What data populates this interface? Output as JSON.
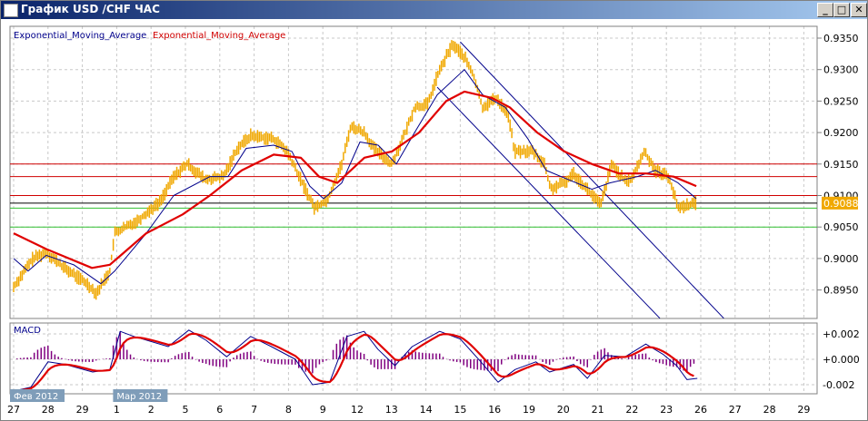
{
  "window": {
    "title": "График USD /CHF  ЧАС",
    "minimize": "_",
    "maximize": "□",
    "close": "✕"
  },
  "legend": {
    "ema_fast": "Exponential_Moving_Average",
    "ema_slow": "Exponential_Moving_Average"
  },
  "colors": {
    "price": "#f0a800",
    "ema_fast": "#00008b",
    "ema_slow": "#e00000",
    "macd_hist": "#800080",
    "grid": "#c8c8c8"
  },
  "chart_data": [
    {
      "type": "line",
      "title": "USD/CHF H1",
      "x_ticks": [
        "27",
        "28",
        "29",
        "1",
        "2",
        "5",
        "6",
        "7",
        "8",
        "9",
        "12",
        "13",
        "14",
        "15",
        "16",
        "19",
        "20",
        "21",
        "22",
        "23",
        "26",
        "27",
        "28",
        "29"
      ],
      "month_labels": [
        {
          "idx": 0,
          "text": "Фев 2012"
        },
        {
          "idx": 3,
          "text": "Мар 2012"
        }
      ],
      "y_ticks": [
        "0.9350",
        "0.9300",
        "0.9250",
        "0.9200",
        "0.9150",
        "0.9100",
        "0.9050",
        "0.9000",
        "0.8950"
      ],
      "ylim": [
        0.891,
        0.937
      ],
      "current_price": "0.9088",
      "price": [
        [
          0,
          0.8955
        ],
        [
          0.56,
          0.9
        ],
        [
          0.95,
          0.901
        ],
        [
          1.48,
          0.8985
        ],
        [
          2.14,
          0.896
        ],
        [
          2.41,
          0.8945
        ],
        [
          2.8,
          0.898
        ],
        [
          2.94,
          0.904
        ],
        [
          3.6,
          0.906
        ],
        [
          4.26,
          0.909
        ],
        [
          4.66,
          0.913
        ],
        [
          5.05,
          0.915
        ],
        [
          5.58,
          0.9125
        ],
        [
          6.11,
          0.913
        ],
        [
          6.51,
          0.9175
        ],
        [
          6.9,
          0.9195
        ],
        [
          7.57,
          0.919
        ],
        [
          7.96,
          0.917
        ],
        [
          8.49,
          0.911
        ],
        [
          8.76,
          0.908
        ],
        [
          9.15,
          0.9095
        ],
        [
          9.55,
          0.915
        ],
        [
          9.81,
          0.921
        ],
        [
          10.21,
          0.92
        ],
        [
          10.48,
          0.9175
        ],
        [
          11.01,
          0.915
        ],
        [
          11.4,
          0.92
        ],
        [
          11.67,
          0.924
        ],
        [
          12.06,
          0.9245
        ],
        [
          12.33,
          0.929
        ],
        [
          12.59,
          0.932
        ],
        [
          12.78,
          0.934
        ],
        [
          13.12,
          0.932
        ],
        [
          13.39,
          0.929
        ],
        [
          13.65,
          0.924
        ],
        [
          14.05,
          0.9255
        ],
        [
          14.39,
          0.923
        ],
        [
          14.58,
          0.917
        ],
        [
          15.11,
          0.917
        ],
        [
          15.45,
          0.915
        ],
        [
          15.63,
          0.911
        ],
        [
          16.03,
          0.912
        ],
        [
          16.3,
          0.9135
        ],
        [
          16.69,
          0.911
        ],
        [
          17.09,
          0.9085
        ],
        [
          17.41,
          0.915
        ],
        [
          17.83,
          0.912
        ],
        [
          18.02,
          0.913
        ],
        [
          18.36,
          0.917
        ],
        [
          18.68,
          0.914
        ],
        [
          19.07,
          0.913
        ],
        [
          19.34,
          0.908
        ],
        [
          19.6,
          0.9085
        ],
        [
          19.87,
          0.9088
        ]
      ],
      "ema_fast": [
        [
          0,
          0.9
        ],
        [
          0.42,
          0.898
        ],
        [
          0.95,
          0.9005
        ],
        [
          1.75,
          0.899
        ],
        [
          2.54,
          0.896
        ],
        [
          2.94,
          0.898
        ],
        [
          3.86,
          0.904
        ],
        [
          4.66,
          0.91
        ],
        [
          5.71,
          0.913
        ],
        [
          6.24,
          0.913
        ],
        [
          6.77,
          0.9175
        ],
        [
          7.57,
          0.918
        ],
        [
          8.1,
          0.917
        ],
        [
          8.62,
          0.9115
        ],
        [
          9.02,
          0.9095
        ],
        [
          9.55,
          0.912
        ],
        [
          10.08,
          0.9185
        ],
        [
          10.61,
          0.918
        ],
        [
          11.14,
          0.915
        ],
        [
          11.67,
          0.92
        ],
        [
          12.33,
          0.926
        ],
        [
          13.12,
          0.93
        ],
        [
          13.65,
          0.926
        ],
        [
          14.31,
          0.924
        ],
        [
          14.97,
          0.919
        ],
        [
          15.5,
          0.914
        ],
        [
          16.16,
          0.9125
        ],
        [
          16.83,
          0.911
        ],
        [
          17.35,
          0.912
        ],
        [
          18.15,
          0.913
        ],
        [
          18.68,
          0.914
        ],
        [
          19.34,
          0.912
        ],
        [
          19.87,
          0.9095
        ]
      ],
      "ema_slow": [
        [
          0,
          0.904
        ],
        [
          0.95,
          0.9015
        ],
        [
          2.28,
          0.8985
        ],
        [
          2.8,
          0.899
        ],
        [
          3.86,
          0.904
        ],
        [
          4.92,
          0.907
        ],
        [
          5.71,
          0.91
        ],
        [
          6.64,
          0.914
        ],
        [
          7.57,
          0.9165
        ],
        [
          8.36,
          0.916
        ],
        [
          8.89,
          0.913
        ],
        [
          9.42,
          0.912
        ],
        [
          10.21,
          0.916
        ],
        [
          11.01,
          0.917
        ],
        [
          11.8,
          0.92
        ],
        [
          12.59,
          0.925
        ],
        [
          13.12,
          0.9265
        ],
        [
          13.92,
          0.9255
        ],
        [
          14.44,
          0.924
        ],
        [
          15.24,
          0.92
        ],
        [
          16.03,
          0.917
        ],
        [
          16.83,
          0.915
        ],
        [
          17.62,
          0.9135
        ],
        [
          18.41,
          0.9135
        ],
        [
          19.21,
          0.913
        ],
        [
          19.87,
          0.9115
        ]
      ],
      "hlines": [
        {
          "price": 0.915,
          "color": "#d00000"
        },
        {
          "price": 0.913,
          "color": "#d00000"
        },
        {
          "price": 0.91,
          "color": "#d00000"
        },
        {
          "price": 0.9088,
          "color": "#000000"
        },
        {
          "price": 0.908,
          "color": "#30c030"
        },
        {
          "price": 0.905,
          "color": "#30c030"
        }
      ],
      "channel": [
        [
          [
            13,
            0.9344
          ],
          [
            20.67,
            0.8905
          ]
        ],
        [
          [
            12.33,
            0.9272
          ],
          [
            18.81,
            0.8905
          ]
        ]
      ]
    },
    {
      "type": "line",
      "title": "MACD",
      "y_ticks": [
        "+0.002",
        "+0.000",
        "-0.002"
      ],
      "macd": [
        [
          0,
          -0.0025
        ],
        [
          0.5,
          -0.0022
        ],
        [
          1,
          -0.0002
        ],
        [
          1.5,
          -0.0004
        ],
        [
          2.3,
          -0.001
        ],
        [
          2.8,
          -0.0008
        ],
        [
          3.1,
          0.0022
        ],
        [
          3.5,
          0.0018
        ],
        [
          4.5,
          0.001
        ],
        [
          5.1,
          0.0023
        ],
        [
          5.6,
          0.0015
        ],
        [
          6.2,
          0.0002
        ],
        [
          6.9,
          0.0018
        ],
        [
          7.5,
          0.001
        ],
        [
          8.2,
          0
        ],
        [
          8.7,
          -0.002
        ],
        [
          9.2,
          -0.0018
        ],
        [
          9.7,
          0.0018
        ],
        [
          10.2,
          0.0022
        ],
        [
          10.6,
          0.0008
        ],
        [
          11.1,
          -0.0005
        ],
        [
          11.6,
          0.001
        ],
        [
          12.4,
          0.0022
        ],
        [
          13,
          0.0016
        ],
        [
          13.6,
          -0.0002
        ],
        [
          14.1,
          -0.0018
        ],
        [
          14.6,
          -0.0008
        ],
        [
          15.2,
          -0.0002
        ],
        [
          15.6,
          -0.001
        ],
        [
          16.3,
          -0.0004
        ],
        [
          16.7,
          -0.0015
        ],
        [
          17.2,
          0.0003
        ],
        [
          17.8,
          0.0002
        ],
        [
          18.4,
          0.0012
        ],
        [
          18.9,
          0.0004
        ],
        [
          19.3,
          -0.0005
        ],
        [
          19.6,
          -0.0016
        ],
        [
          19.9,
          -0.0015
        ]
      ]
    }
  ]
}
